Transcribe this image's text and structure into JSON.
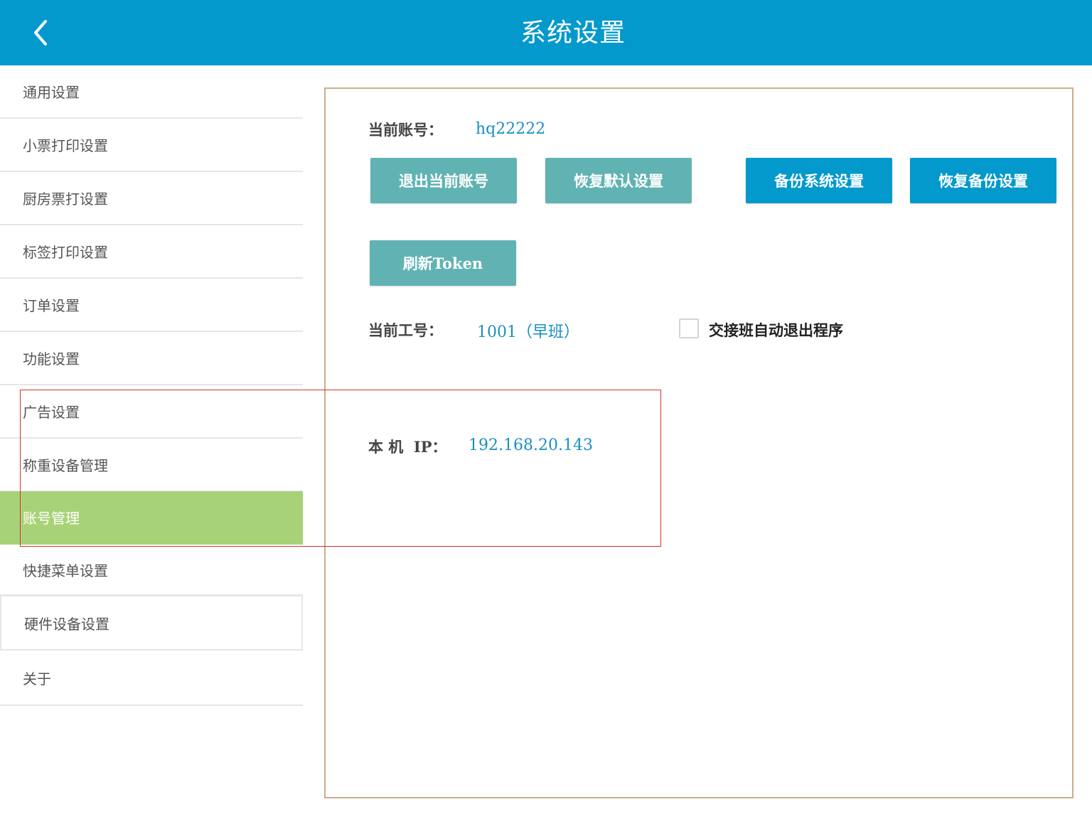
{
  "header": {
    "title": "系统设置",
    "back_icon": "chevron-left-icon"
  },
  "sidebar": {
    "active_index": 8,
    "items": [
      {
        "label": "通用设置"
      },
      {
        "label": "小票打印设置"
      },
      {
        "label": "厨房票打设置"
      },
      {
        "label": "标签打印设置"
      },
      {
        "label": "订单设置"
      },
      {
        "label": "功能设置"
      },
      {
        "label": "广告设置"
      },
      {
        "label": "称重设备管理"
      },
      {
        "label": "账号管理"
      },
      {
        "label": "快捷菜单设置"
      },
      {
        "label": "硬件设备设置"
      },
      {
        "label": "关于"
      }
    ]
  },
  "account": {
    "current_account_label": "当前账号：",
    "current_account_value": "hq22222",
    "buttons": {
      "logout": "退出当前账号",
      "restore_default": "恢复默认设置",
      "backup": "备份系统设置",
      "restore_backup": "恢复备份设置",
      "refresh_token": "刷新Token"
    },
    "current_staff_label": "当前工号：",
    "current_staff_value": "1001（早班）",
    "auto_exit_checkbox_label": "交接班自动退出程序",
    "auto_exit_checked": false,
    "local_ip_label": "本 机  IP：",
    "local_ip_value": "192.168.20.143"
  },
  "colors": {
    "header": "#0399cc",
    "active_item": "#a8d277",
    "teal_button": "#61b3b3",
    "blue_button": "#0399cc",
    "value_text": "#1a8fc0",
    "panel_border": "#c9ad8e",
    "highlight": "#d9302e"
  }
}
